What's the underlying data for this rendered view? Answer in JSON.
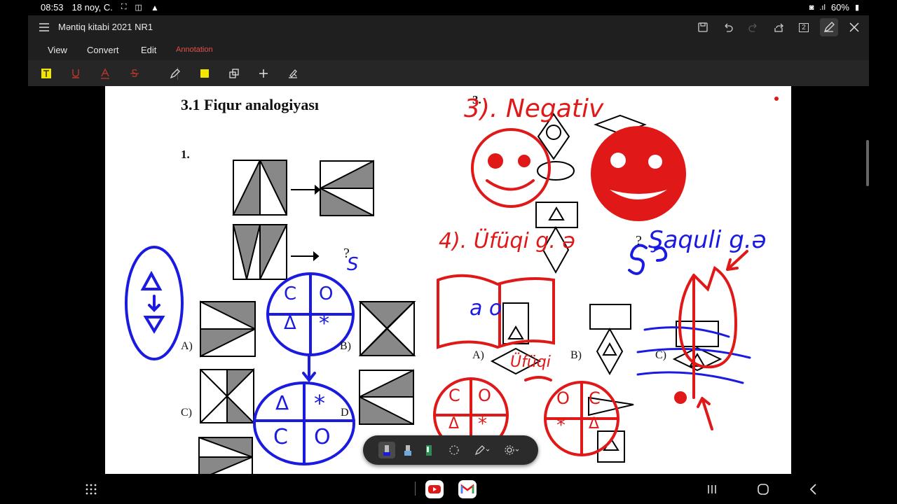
{
  "status": {
    "time": "08:53",
    "date": "18 noy, C.",
    "battery": "60%"
  },
  "app": {
    "doc_title": "Məntiq kitabi 2021 NR1",
    "page_badge": "2",
    "tabs": [
      {
        "label": "View"
      },
      {
        "label": "Convert"
      },
      {
        "label": "Edit"
      },
      {
        "label": "Annotation",
        "active": true
      }
    ],
    "accent_color": "#e0534c",
    "highlight_color": "#f2e600"
  },
  "page": {
    "heading": "3.1  Fiqur  analogiyası",
    "question_1": "1.",
    "question_3_num": "3.",
    "option_a_left": "A)",
    "option_b_left": "B)",
    "option_c_left": "C)",
    "option_d_left": "D",
    "option_a_right": "A)",
    "option_b_right": "B)",
    "option_c_right": "C)",
    "qmark_left": "?",
    "qmark_right": "?",
    "handwriting": {
      "s_label": "S",
      "negativ": "3). Negativ",
      "ufuqi": "4). Üfüqi g. ə",
      "saquli": "Şaquli g.ə",
      "a_o": "a o",
      "ufuqi_small": "Üfüqi"
    },
    "circle_letters": [
      "C",
      "O",
      "Δ",
      "*"
    ],
    "circle_letters_2": [
      "Δ",
      "*",
      "C",
      "O"
    ],
    "triangle_symbol": "Δ"
  }
}
